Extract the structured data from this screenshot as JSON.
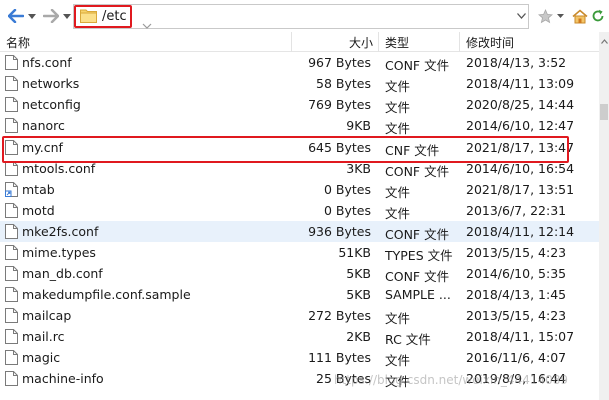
{
  "toolbar": {
    "path": "/etc"
  },
  "columns": {
    "name": "名称",
    "size": "大小",
    "type": "类型",
    "modified": "修改时间"
  },
  "files": [
    {
      "name": "nfs.conf",
      "size": "967 Bytes",
      "type": "CONF 文件",
      "modified": "2018/4/13, 3:52",
      "icon": "file-icon"
    },
    {
      "name": "networks",
      "size": "58 Bytes",
      "type": "文件",
      "modified": "2018/4/11, 13:09",
      "icon": "file-icon"
    },
    {
      "name": "netconfig",
      "size": "769 Bytes",
      "type": "文件",
      "modified": "2020/8/25, 14:44",
      "icon": "file-icon"
    },
    {
      "name": "nanorc",
      "size": "9KB",
      "type": "文件",
      "modified": "2014/6/10, 12:47",
      "icon": "file-icon"
    },
    {
      "name": "my.cnf",
      "size": "645 Bytes",
      "type": "CNF 文件",
      "modified": "2021/8/17, 13:47",
      "icon": "file-icon"
    },
    {
      "name": "mtools.conf",
      "size": "3KB",
      "type": "CONF 文件",
      "modified": "2014/6/10, 16:54",
      "icon": "file-icon"
    },
    {
      "name": "mtab",
      "size": "0 Bytes",
      "type": "文件",
      "modified": "2021/8/17, 13:51",
      "icon": "symlink-file-icon"
    },
    {
      "name": "motd",
      "size": "0 Bytes",
      "type": "文件",
      "modified": "2013/6/7, 22:31",
      "icon": "file-icon"
    },
    {
      "name": "mke2fs.conf",
      "size": "936 Bytes",
      "type": "CONF 文件",
      "modified": "2018/4/11, 12:14",
      "icon": "file-icon"
    },
    {
      "name": "mime.types",
      "size": "51KB",
      "type": "TYPES 文件",
      "modified": "2013/5/15, 4:23",
      "icon": "file-icon"
    },
    {
      "name": "man_db.conf",
      "size": "5KB",
      "type": "CONF 文件",
      "modified": "2014/6/10, 5:35",
      "icon": "file-icon"
    },
    {
      "name": "makedumpfile.conf.sample",
      "size": "5KB",
      "type": "SAMPLE ...",
      "modified": "2018/4/13, 1:45",
      "icon": "file-icon"
    },
    {
      "name": "mailcap",
      "size": "272 Bytes",
      "type": "文件",
      "modified": "2013/5/15, 4:23",
      "icon": "file-icon"
    },
    {
      "name": "mail.rc",
      "size": "2KB",
      "type": "RC 文件",
      "modified": "2018/4/11, 15:07",
      "icon": "file-icon"
    },
    {
      "name": "magic",
      "size": "111 Bytes",
      "type": "文件",
      "modified": "2016/11/6, 4:07",
      "icon": "file-icon"
    },
    {
      "name": "machine-info",
      "size": "25 Bytes",
      "type": "文件",
      "modified": "2019/8/9, 16:44",
      "icon": "file-icon"
    }
  ],
  "watermark": "https://blog.csdn.net/weixin_44414089",
  "colors": {
    "highlight": "#e0191f",
    "selected_row": "#e8f1fb",
    "nav_arrow": "#3a7bd5"
  }
}
